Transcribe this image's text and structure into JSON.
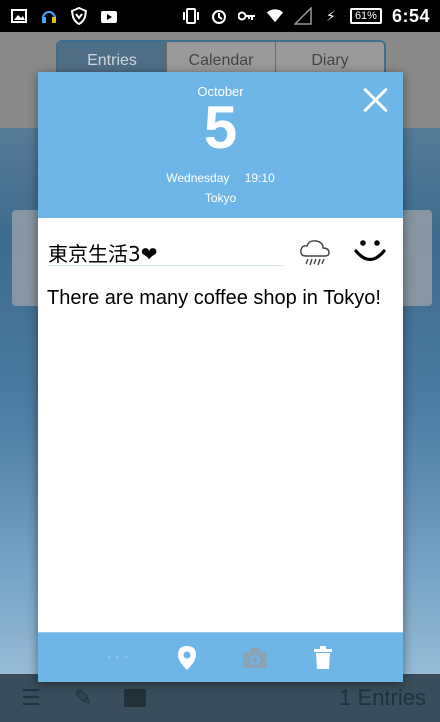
{
  "statusbar": {
    "battery": "61%",
    "time": "6:54"
  },
  "tabs": [
    "Entries",
    "Calendar",
    "Diary"
  ],
  "entry": {
    "month": "October",
    "day": "5",
    "weekday": "Wednesday",
    "time": "19:10",
    "location": "Tokyo",
    "title": "東京生活3❤",
    "body": "There are many coffee shop in Tokyo!",
    "weather_icon": "rain-cloud-icon",
    "mood_icon": "smiley-icon"
  },
  "bottom_bar": {
    "count_label": "1 Entries"
  },
  "colors": {
    "header_blue": "#6fb6e8",
    "text": "#000000"
  }
}
